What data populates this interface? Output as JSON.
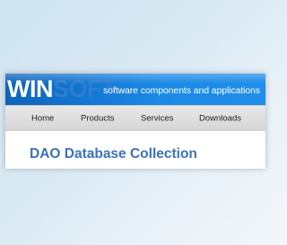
{
  "header": {
    "logo_primary": "WIN",
    "logo_secondary": "SOFT",
    "tagline": "software components and applications"
  },
  "nav": {
    "items": [
      {
        "label": "Home"
      },
      {
        "label": "Products"
      },
      {
        "label": "Services"
      },
      {
        "label": "Downloads"
      }
    ]
  },
  "main": {
    "title": "DAO Database Collection"
  },
  "colors": {
    "banner": "#1479d6",
    "logo_secondary": "#2a7fd1",
    "title": "#3d73b5",
    "nav_bg": "#dedede"
  }
}
